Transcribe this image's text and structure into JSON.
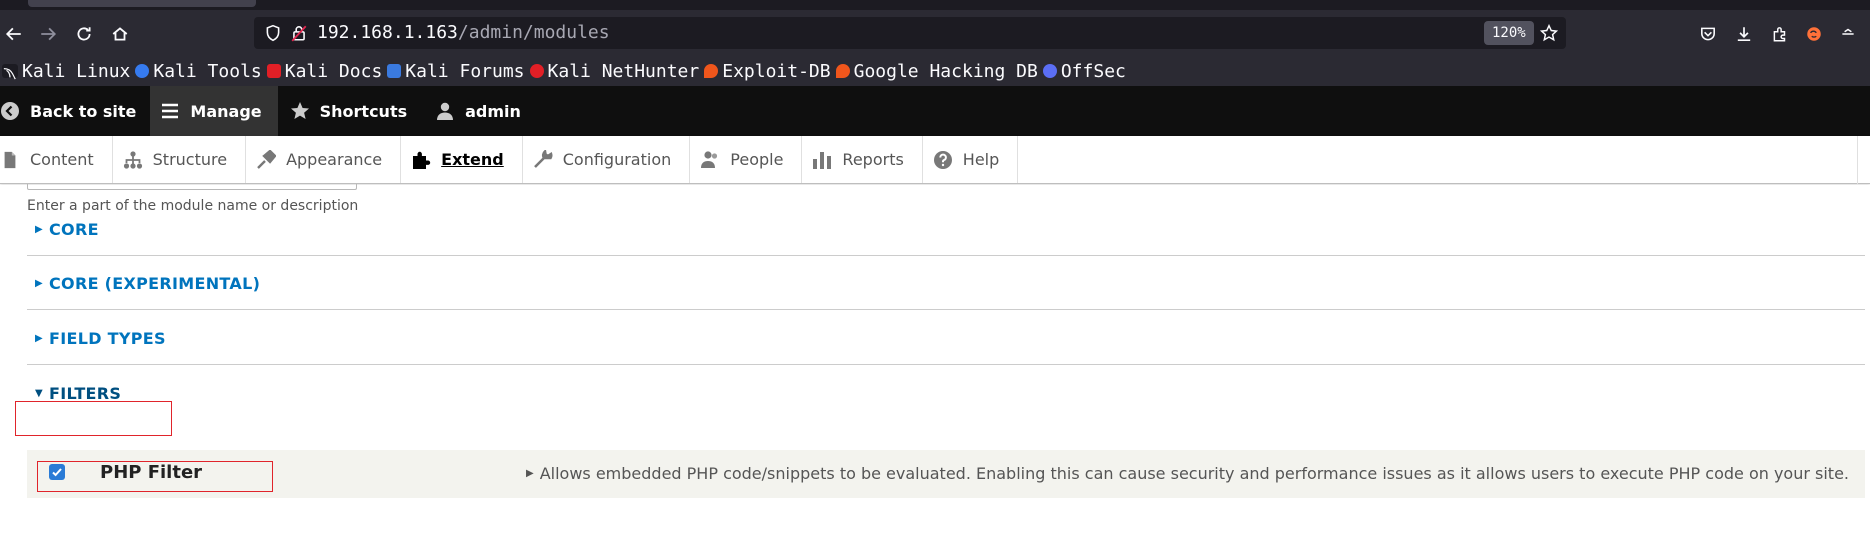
{
  "browser": {
    "url_host": "192.168.1.163",
    "url_path": "/admin/modules",
    "zoom": "120%",
    "icons": [
      "back-icon",
      "forward-icon",
      "reload-icon",
      "home-icon",
      "shield-icon",
      "lock-icon",
      "star-icon",
      "pocket-icon",
      "download-icon",
      "extensions-icon",
      "firefox-account-icon",
      "menu-icon"
    ],
    "bookmarks": [
      {
        "label": "Kali Linux",
        "color": "#367bf0"
      },
      {
        "label": "Kali Tools",
        "color": "#367bf0"
      },
      {
        "label": "Kali Docs",
        "color": "#e21f26"
      },
      {
        "label": "Kali Forums",
        "color": "#3a7ae0"
      },
      {
        "label": "Kali NetHunter",
        "color": "#e21f26"
      },
      {
        "label": "Exploit-DB",
        "color": "#f0561c"
      },
      {
        "label": "Google Hacking DB",
        "color": "#f0561c"
      },
      {
        "label": "OffSec",
        "color": "#5b6ef5"
      }
    ]
  },
  "toolbar": {
    "back_to_site": "Back to site",
    "manage": "Manage",
    "shortcuts": "Shortcuts",
    "user": "admin"
  },
  "tray": {
    "items": [
      {
        "label": "Content",
        "icon": "file-icon"
      },
      {
        "label": "Structure",
        "icon": "structure-icon"
      },
      {
        "label": "Appearance",
        "icon": "brush-icon"
      },
      {
        "label": "Extend",
        "icon": "puzzle-icon",
        "active": true
      },
      {
        "label": "Configuration",
        "icon": "wrench-icon"
      },
      {
        "label": "People",
        "icon": "people-icon"
      },
      {
        "label": "Reports",
        "icon": "bar-chart-icon"
      },
      {
        "label": "Help",
        "icon": "help-icon"
      }
    ]
  },
  "main": {
    "filter_description": "Enter a part of the module name or description",
    "packages": [
      {
        "label": "CORE",
        "expanded": false
      },
      {
        "label": "CORE (EXPERIMENTAL)",
        "expanded": false
      },
      {
        "label": "FIELD TYPES",
        "expanded": false
      },
      {
        "label": "FILTERS",
        "expanded": true
      }
    ],
    "module": {
      "name": "PHP Filter",
      "checked": true,
      "description": "Allows embedded PHP code/snippets to be evaluated. Enabling this can cause security and performance issues as it allows users to execute PHP code on your site."
    }
  },
  "colors": {
    "link": "#0074bd",
    "highlight": "#e0242b",
    "checkbox": "#2a7bd6"
  }
}
